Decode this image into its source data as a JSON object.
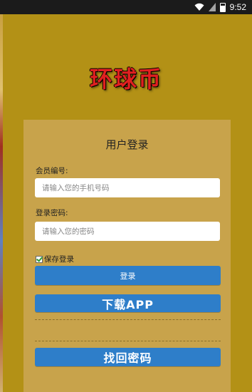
{
  "status_bar": {
    "time": "9:52",
    "icons": [
      "wifi-icon",
      "battery-icon"
    ]
  },
  "app": {
    "title": "环球币"
  },
  "login_panel": {
    "title": "用户登录",
    "member_id": {
      "label": "会员编号:",
      "placeholder": "请输入您的手机号码",
      "value": ""
    },
    "password": {
      "label": "登录密码:",
      "placeholder": "请输入您的密码",
      "value": ""
    },
    "remember": {
      "label": "保存登录",
      "checked": true
    },
    "login_button": "登录",
    "download_button": "下载APP",
    "recover_button": "找回密码"
  },
  "colors": {
    "background": "#b39116",
    "panel": "#c8a34b",
    "button": "#2e7ec9",
    "title_red": "#e02020"
  }
}
